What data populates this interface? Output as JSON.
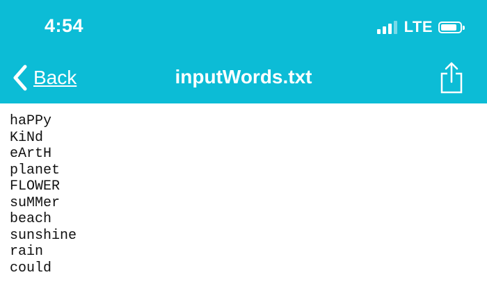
{
  "status_bar": {
    "time": "4:54",
    "network": "LTE",
    "signal_bars_active": 3,
    "signal_bars_total": 4,
    "battery_icon": "battery-icon"
  },
  "nav_bar": {
    "back_label": "Back",
    "title": "inputWords.txt",
    "back_icon": "chevron-left-icon",
    "share_icon": "share-icon"
  },
  "file": {
    "lines": [
      "haPPy",
      "KiNd",
      "eArtH",
      "planet",
      "FLOWER",
      "suMMer",
      "beach",
      "sunshine",
      "rain",
      "could"
    ]
  },
  "colors": {
    "header_bg": "#0cbcd6",
    "header_text": "#ffffff",
    "body_bg": "#ffffff",
    "body_text": "#111111"
  }
}
